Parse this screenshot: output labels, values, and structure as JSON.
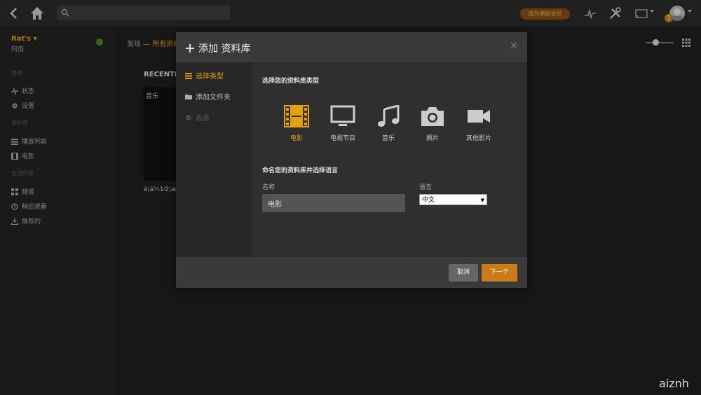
{
  "topbar": {
    "premium_label": "成为高级会员",
    "notification_count": "1",
    "search_placeholder": ""
  },
  "sidebar": {
    "server_name": "Rat's",
    "server_sub": "阿旋",
    "sections": {
      "manage": "管理",
      "libraries": "资料库",
      "online": "在线内容"
    },
    "items": [
      {
        "label": "状态",
        "icon": "activity-icon"
      },
      {
        "label": "设置",
        "icon": "gear-icon"
      },
      {
        "label": "播放列表",
        "icon": "playlist-icon"
      },
      {
        "label": "电影",
        "icon": "film-icon"
      },
      {
        "label": "频道",
        "icon": "channels-icon"
      },
      {
        "label": "稍后观看",
        "icon": "clock-icon"
      },
      {
        "label": "推荐的",
        "icon": "download-icon"
      }
    ]
  },
  "main": {
    "breadcrumb_home": "发现",
    "breadcrumb_sep": " — ",
    "breadcrumb_current": "所有资料",
    "recently_title": "RECENTLY",
    "poster_label": "音乐",
    "poster_title": "è¦ä½1⁄2¦æ-"
  },
  "modal": {
    "title": "添加 资料库",
    "steps": [
      {
        "label": "选择类型",
        "state": "active"
      },
      {
        "label": "添加文件夹",
        "state": "normal"
      },
      {
        "label": "高级",
        "state": "disabled"
      }
    ],
    "select_type_heading": "选择您的资料库类型",
    "types": [
      {
        "label": "电影",
        "icon": "film-strip-icon",
        "active": true
      },
      {
        "label": "电视节目",
        "icon": "tv-icon",
        "active": false
      },
      {
        "label": "音乐",
        "icon": "music-note-icon",
        "active": false
      },
      {
        "label": "照片",
        "icon": "camera-icon",
        "active": false
      },
      {
        "label": "其他影片",
        "icon": "video-camera-icon",
        "active": false
      }
    ],
    "name_heading": "命名您的资料库并选择语言",
    "name_label": "名称",
    "name_value": "电影",
    "language_label": "语言",
    "language_value": "中文",
    "cancel_label": "取消",
    "next_label": "下一个"
  },
  "watermark": "aiznh",
  "colors": {
    "accent": "#e5a00d",
    "next_button": "#cc7b19",
    "background": "#1f1f1f"
  }
}
